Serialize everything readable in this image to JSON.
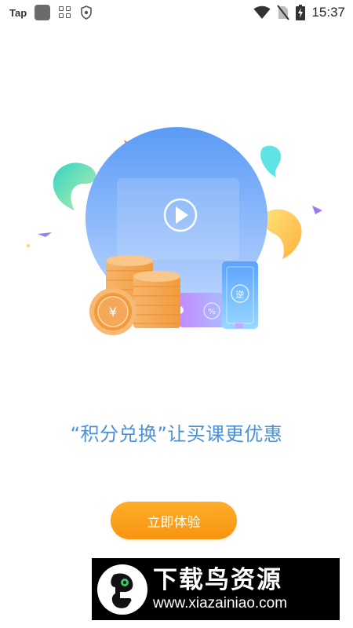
{
  "status_bar": {
    "app_label": "Tap",
    "time": "15:37",
    "icons": [
      "app-square-icon",
      "grid-icon",
      "shield-icon",
      "wifi-icon",
      "no-sim-icon",
      "battery-charging-icon"
    ]
  },
  "illustration": {
    "icons": [
      "play-icon",
      "coin-stack-icon",
      "yuan-coin-icon",
      "coupon-icon",
      "ticket-icon"
    ],
    "coin_symbol": "¥",
    "coupon_symbol": "%",
    "ticket_symbol": "逆"
  },
  "main": {
    "slogan": "“积分兑换”让买课更优惠",
    "cta_label": "立即体验"
  },
  "watermark": {
    "title": "下载鸟资源",
    "url": "www.xiazainiao.com"
  },
  "colors": {
    "accent_blue": "#4a90d9",
    "button_orange": "#f79410",
    "circle_blue": "#6aa7f8"
  }
}
